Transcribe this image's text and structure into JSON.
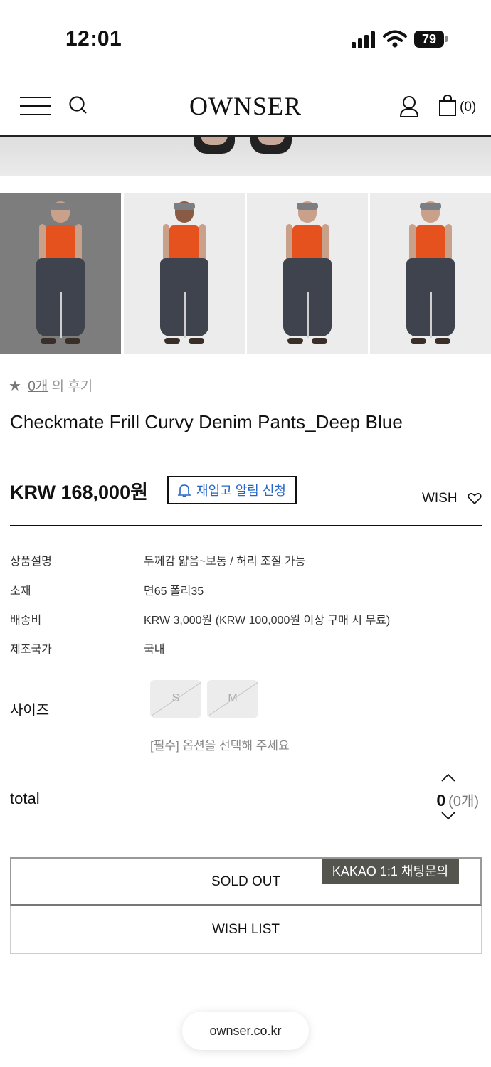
{
  "status_bar": {
    "time": "12:01",
    "battery": "79"
  },
  "header": {
    "logo": "OWNSER",
    "cart_count": "(0)"
  },
  "review": {
    "count": "0개",
    "suffix": "의 후기"
  },
  "product": {
    "name": "Checkmate Frill Curvy Denim Pants_Deep Blue",
    "price": "KRW 168,000원",
    "restock_label": "재입고 알림 신청",
    "wish_label": "WISH"
  },
  "info": [
    {
      "key": "상품설명",
      "value": "두께감 얇음~보통 / 허리 조절 가능"
    },
    {
      "key": "소재",
      "value": "면65 폴리35"
    },
    {
      "key": "배송비",
      "value": "KRW 3,000원 (KRW 100,000원 이상 구매 시 무료)"
    },
    {
      "key": "제조국가",
      "value": "국내"
    }
  ],
  "size": {
    "label": "사이즈",
    "options": [
      "S",
      "M"
    ],
    "hint": "[필수] 옵션을 선택해 주세요"
  },
  "total": {
    "label": "total",
    "amount": "0",
    "count": "(0개)"
  },
  "buttons": {
    "sold_out": "SOLD OUT",
    "wish_list": "WISH LIST",
    "kakao": "KAKAO 1:1 채팅문의"
  },
  "browser": {
    "url": "ownser.co.kr"
  }
}
